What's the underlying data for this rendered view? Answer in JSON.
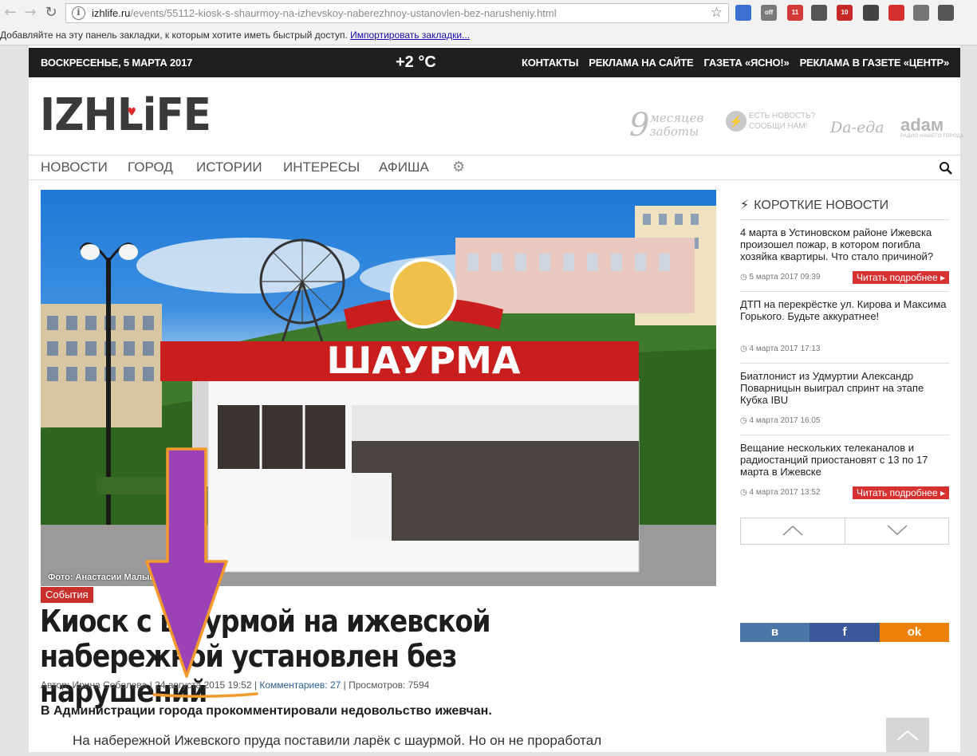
{
  "browser": {
    "url_host": "izhlife.ru",
    "url_path": "/events/55112-kiosk-s-shaurmoy-na-izhevskoy-naberezhnoy-ustanovlen-bez-narusheniy.html",
    "bookmarks_text": "Добавляйте на эту панель закладки, к которым хотите иметь быстрый доступ.",
    "bookmarks_link": "Импортировать закладки...",
    "extensions": [
      {
        "name": "speaker-extension-icon",
        "badge": "",
        "color": "#3b6fd1"
      },
      {
        "name": "off-extension-icon",
        "badge": "off",
        "color": "#7a7a7a"
      },
      {
        "name": "pocket-extension-icon",
        "badge": "11",
        "color": "#d33a3a"
      },
      {
        "name": "globe-extension-icon",
        "badge": "",
        "color": "#555555"
      },
      {
        "name": "abp-extension-icon",
        "badge": "10",
        "color": "#c62828"
      },
      {
        "name": "dots-extension-icon",
        "badge": "",
        "color": "#444444"
      },
      {
        "name": "youtube-extension-icon",
        "badge": "",
        "color": "#d32f2f"
      },
      {
        "name": "puzzle-extension-icon",
        "badge": "",
        "color": "#757575"
      },
      {
        "name": "vivaldi-extension-icon",
        "badge": "",
        "color": "#555555"
      }
    ]
  },
  "site": {
    "date": "ВОСКРЕСЕНЬЕ, 5 МАРТА 2017",
    "temperature": "+2 °C",
    "top_links": [
      "КОНТАКТЫ",
      "РЕКЛАМА НА САЙТЕ",
      "ГАЗЕТА «ЯСНО!»",
      "РЕКЛАМА В ГАЗЕТЕ «ЦЕНТР»"
    ],
    "logo_text": "IZHLiFE",
    "promo_9": "9",
    "promo_months": "месяцев",
    "promo_care": "заботы",
    "promo_news_1": "ЕСТЬ НОВОСТЬ?",
    "promo_news_2": "СООБЩИ НАМ!",
    "promo_daeda": "Da-еда",
    "promo_adam": "adам",
    "promo_adam_sub": "РАДИО НАШЕГО ГОРОДА",
    "nav": [
      "НОВОСТИ",
      "ГОРОД",
      "ИСТОРИИ",
      "ИНТЕРЕСЫ",
      "АФИША"
    ]
  },
  "article": {
    "photo_credit": "Фото: Анастасии Малыше",
    "kiosk_sign": "ШАУРМА",
    "category": "События",
    "title": "Киоск с шаурмой на ижевской набережной установлен без нарушений",
    "author": "Автор: Ирина Соболева",
    "date": "24 августа 2015  19:52",
    "comments": "Комментариев: 27",
    "views": "Просмотров: 7594",
    "lead": "В Администрации города прокомментировали недовольство ижевчан.",
    "body_start": "На набережной Ижевского пруда поставили ларёк с шаурмой. Но он не проработал"
  },
  "sidebar": {
    "title": "КОРОТКИЕ НОВОСТИ",
    "read_more": "Читать подробнее ▸",
    "news": [
      {
        "text": "4 марта в Устиновском районе Ижевска произошел пожар, в котором погибла хозяйка квартиры. Что стало причиной?",
        "date": "5 марта 2017 09:39",
        "has_read_more": true
      },
      {
        "text": "ДТП на перекрёстке ул. Кирова и Максима Горького. Будьте аккуратнее!",
        "date": "4 марта 2017 17:13",
        "has_read_more": false
      },
      {
        "text": "Биатлонист из Удмуртии Александр Поварницын выиграл спринт на этапе Кубка IBU",
        "date": "4 марта 2017 16:05",
        "has_read_more": false
      },
      {
        "text": "Вещание нескольких телеканалов и радиостанций приостановят с 13 по 17 марта в Ижевске",
        "date": "4 марта 2017 13:52",
        "has_read_more": true
      }
    ],
    "share": [
      {
        "label": "в",
        "color": "#4a76a8"
      },
      {
        "label": "f",
        "color": "#3b5998"
      },
      {
        "label": "ok",
        "color": "#ee8208"
      }
    ]
  },
  "colors": {
    "accent_red": "#c9302c",
    "annotation_arrow": "#9b43b5",
    "annotation_outline": "#f39a2c"
  }
}
